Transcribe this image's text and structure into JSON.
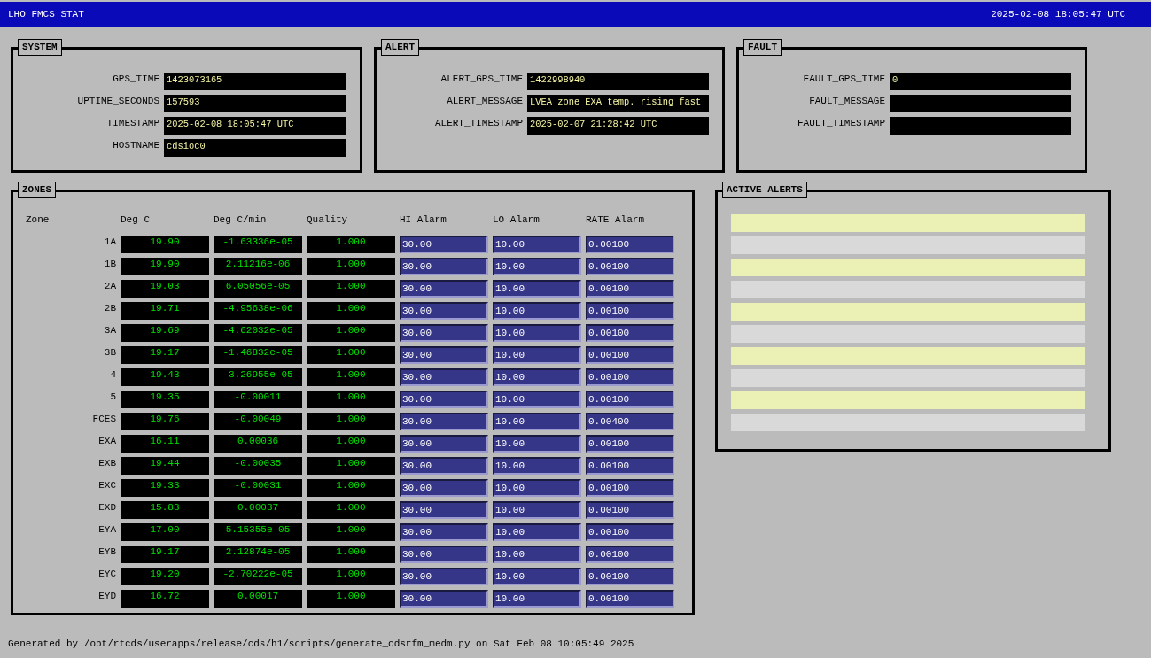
{
  "title_bar": {
    "title": "LHO FMCS STAT",
    "datetime": "2025-02-08 18:05:47 UTC"
  },
  "panels": [
    {
      "title": "SYSTEM",
      "fields": [
        {
          "label": "GPS_TIME",
          "value": "1423073165"
        },
        {
          "label": "UPTIME_SECONDS",
          "value": "157593"
        },
        {
          "label": "TIMESTAMP",
          "value": "2025-02-08 18:05:47 UTC"
        },
        {
          "label": "HOSTNAME",
          "value": "cdsioc0"
        }
      ]
    },
    {
      "title": "ALERT",
      "fields": [
        {
          "label": "ALERT_GPS_TIME",
          "value": "1422998940"
        },
        {
          "label": "ALERT_MESSAGE",
          "value": "LVEA zone EXA temp. rising fast"
        },
        {
          "label": "ALERT_TIMESTAMP",
          "value": "2025-02-07 21:28:42 UTC"
        }
      ]
    },
    {
      "title": "FAULT",
      "fields": [
        {
          "label": "FAULT_GPS_TIME",
          "value": "0"
        },
        {
          "label": "FAULT_MESSAGE"
        },
        {
          "label": "FAULT_TIMESTAMP"
        }
      ]
    }
  ],
  "zones": {
    "title": "ZONES",
    "columns": [
      "Zone",
      "Deg C",
      "Deg C/min",
      "Quality",
      "HI Alarm",
      "LO Alarm",
      "RATE Alarm"
    ],
    "rows": [
      {
        "zone": "1A",
        "deg_c": "19.90",
        "rate": "-1.63336e-05",
        "quality": "1.000",
        "hi_alarm": "30.00",
        "lo_alarm": "10.00",
        "rate_alarm": "0.00100"
      },
      {
        "zone": "1B",
        "deg_c": "19.90",
        "rate": "2.11216e-06",
        "quality": "1.000",
        "hi_alarm": "30.00",
        "lo_alarm": "10.00",
        "rate_alarm": "0.00100"
      },
      {
        "zone": "2A",
        "deg_c": "19.03",
        "rate": "6.05056e-05",
        "quality": "1.000",
        "hi_alarm": "30.00",
        "lo_alarm": "10.00",
        "rate_alarm": "0.00100"
      },
      {
        "zone": "2B",
        "deg_c": "19.71",
        "rate": "-4.95638e-06",
        "quality": "1.000",
        "hi_alarm": "30.00",
        "lo_alarm": "10.00",
        "rate_alarm": "0.00100"
      },
      {
        "zone": "3A",
        "deg_c": "19.69",
        "rate": "-4.62032e-05",
        "quality": "1.000",
        "hi_alarm": "30.00",
        "lo_alarm": "10.00",
        "rate_alarm": "0.00100"
      },
      {
        "zone": "3B",
        "deg_c": "19.17",
        "rate": "-1.46832e-05",
        "quality": "1.000",
        "hi_alarm": "30.00",
        "lo_alarm": "10.00",
        "rate_alarm": "0.00100"
      },
      {
        "zone": "4",
        "deg_c": "19.43",
        "rate": "-3.26955e-05",
        "quality": "1.000",
        "hi_alarm": "30.00",
        "lo_alarm": "10.00",
        "rate_alarm": "0.00100"
      },
      {
        "zone": "5",
        "deg_c": "19.35",
        "rate": "-0.00011",
        "quality": "1.000",
        "hi_alarm": "30.00",
        "lo_alarm": "10.00",
        "rate_alarm": "0.00100"
      },
      {
        "zone": "FCES",
        "deg_c": "19.76",
        "rate": "-0.00049",
        "quality": "1.000",
        "hi_alarm": "30.00",
        "lo_alarm": "10.00",
        "rate_alarm": "0.00400"
      },
      {
        "zone": "EXA",
        "deg_c": "16.11",
        "rate": "0.00036",
        "quality": "1.000",
        "hi_alarm": "30.00",
        "lo_alarm": "10.00",
        "rate_alarm": "0.00100"
      },
      {
        "zone": "EXB",
        "deg_c": "19.44",
        "rate": "-0.00035",
        "quality": "1.000",
        "hi_alarm": "30.00",
        "lo_alarm": "10.00",
        "rate_alarm": "0.00100"
      },
      {
        "zone": "EXC",
        "deg_c": "19.33",
        "rate": "-0.00031",
        "quality": "1.000",
        "hi_alarm": "30.00",
        "lo_alarm": "10.00",
        "rate_alarm": "0.00100"
      },
      {
        "zone": "EXD",
        "deg_c": "15.83",
        "rate": "0.00037",
        "quality": "1.000",
        "hi_alarm": "30.00",
        "lo_alarm": "10.00",
        "rate_alarm": "0.00100"
      },
      {
        "zone": "EYA",
        "deg_c": "17.00",
        "rate": "5.15355e-05",
        "quality": "1.000",
        "hi_alarm": "30.00",
        "lo_alarm": "10.00",
        "rate_alarm": "0.00100"
      },
      {
        "zone": "EYB",
        "deg_c": "19.17",
        "rate": "2.12874e-05",
        "quality": "1.000",
        "hi_alarm": "30.00",
        "lo_alarm": "10.00",
        "rate_alarm": "0.00100"
      },
      {
        "zone": "EYC",
        "deg_c": "19.20",
        "rate": "-2.70222e-05",
        "quality": "1.000",
        "hi_alarm": "30.00",
        "lo_alarm": "10.00",
        "rate_alarm": "0.00100"
      },
      {
        "zone": "EYD",
        "deg_c": "16.72",
        "rate": "0.00017",
        "quality": "1.000",
        "hi_alarm": "30.00",
        "lo_alarm": "10.00",
        "rate_alarm": "0.00100"
      }
    ]
  },
  "active_alerts": {
    "title": "ACTIVE ALERTS",
    "rows": [
      {
        "color": "#ebf0b4"
      },
      {
        "color": "#d9d9d9"
      },
      {
        "color": "#ebf0b4"
      },
      {
        "color": "#d9d9d9"
      },
      {
        "color": "#ebf0b4"
      },
      {
        "color": "#d9d9d9"
      },
      {
        "color": "#ebf0b4"
      },
      {
        "color": "#d9d9d9"
      },
      {
        "color": "#ebf0b4"
      },
      {
        "color": "#d9d9d9"
      }
    ]
  },
  "footer": "Generated by /opt/rtcds/userapps/release/cds/h1/scripts/generate_cdsrfm_medm.py on Sat Feb 08 10:05:49 2025"
}
